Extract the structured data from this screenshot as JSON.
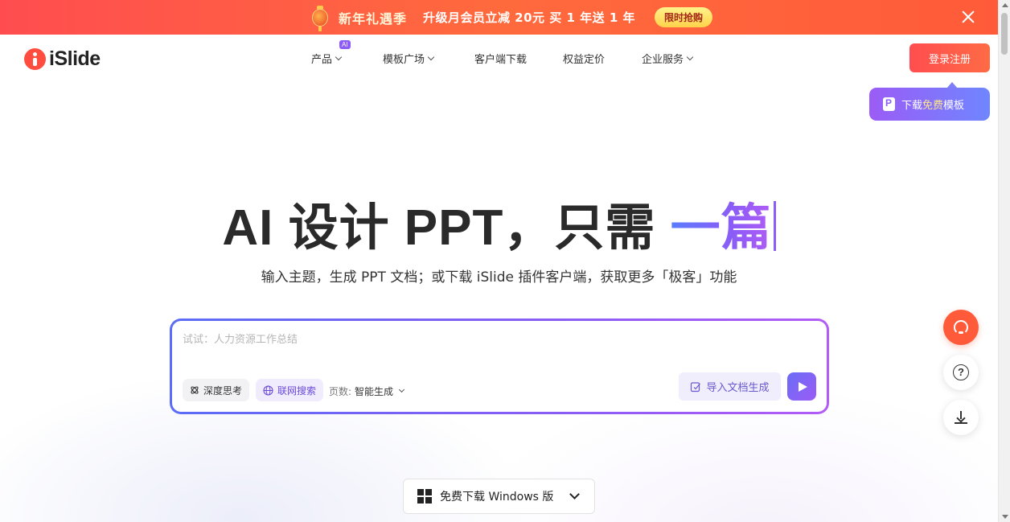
{
  "promo": {
    "title": "新年礼遇季",
    "text": "升级月会员立减 20元  买 1 年送 1 年",
    "cta": "限时抢购"
  },
  "nav": {
    "logo_text": "iSlide",
    "items": [
      {
        "label": "产品",
        "has_dropdown": true,
        "badge": "AI"
      },
      {
        "label": "模板广场",
        "has_dropdown": true
      },
      {
        "label": "客户端下载",
        "has_dropdown": false
      },
      {
        "label": "权益定价",
        "has_dropdown": false
      },
      {
        "label": "企业服务",
        "has_dropdown": true
      }
    ],
    "login": "登录注册"
  },
  "tooltip": {
    "pre": "下载",
    "highlight": "免费",
    "post": "模板"
  },
  "hero": {
    "title_main": "AI 设计 PPT，只需 ",
    "title_accent": "一篇",
    "subtitle": "输入主题，生成 PPT 文档；或下载 iSlide 插件客户端，获取更多「极客」功能"
  },
  "prompt": {
    "placeholder": "试试：人力资源工作总结",
    "value": "",
    "deep_think": "深度思考",
    "web_search": "联网搜索",
    "pages_label": "页数:",
    "pages_value": "智能生成",
    "import_doc": "导入文档生成"
  },
  "download": {
    "label": "免费下载 Windows 版"
  },
  "colors": {
    "brand": "#ff4d4f",
    "accent_purple": "#8b5cf6",
    "accent_blue": "#5b7cff"
  },
  "icons": {
    "support": "headset-icon",
    "help": "question-icon",
    "download": "download-icon",
    "close": "close-icon",
    "send": "send-icon"
  }
}
